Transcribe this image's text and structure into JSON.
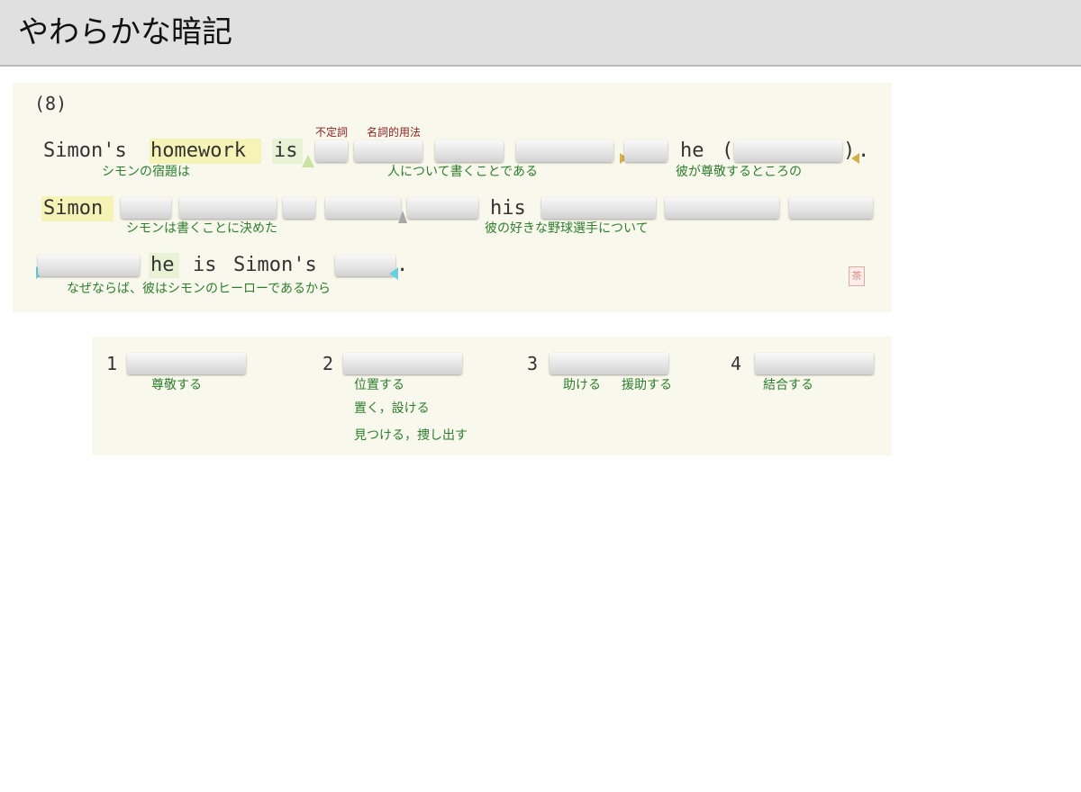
{
  "app": {
    "title": "やわらかな暗記"
  },
  "question": {
    "number": "(8)",
    "line1": {
      "w1": "Simon's",
      "w2": "homework",
      "w3": "is",
      "w4": "he",
      "paren_open": "(",
      "paren_close": ")",
      "period": "."
    },
    "line2": {
      "w1": "Simon",
      "w2": "his"
    },
    "line3": {
      "w1": "he",
      "w2": "is",
      "w3": "Simon's",
      "period": "."
    },
    "grammar_notes": [
      "不定詞",
      "名詞的用法"
    ],
    "glosses": {
      "g1": "シモンの宿題は",
      "g2": "人について書くことである",
      "g3": "彼が尊敬するところの",
      "g4": "シモンは書くことに決めた",
      "g5": "彼の好きな野球選手について",
      "g6": "なぜならば、彼はシモンのヒーローであるから"
    },
    "stamp": "茶"
  },
  "choices": [
    {
      "number": "1",
      "meanings": [
        "尊敬する"
      ]
    },
    {
      "number": "2",
      "meanings": [
        "位置する",
        "置く，設ける",
        "見つける，捜し出す"
      ]
    },
    {
      "number": "3",
      "meanings": [
        "助ける",
        "援助する"
      ]
    },
    {
      "number": "4",
      "meanings": [
        "結合する"
      ]
    }
  ]
}
